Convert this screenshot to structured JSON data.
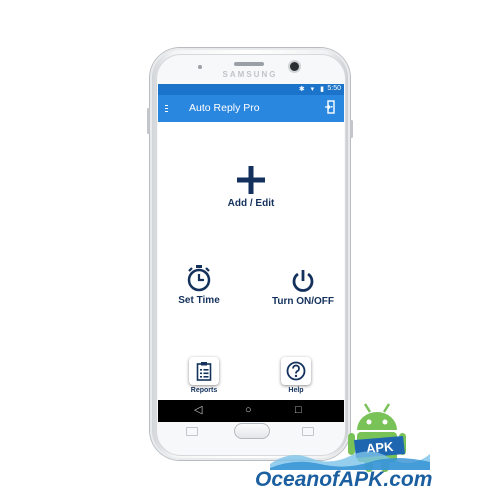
{
  "phone": {
    "brand": "SAMSUNG"
  },
  "status_bar": {
    "icons": "✱ ▾ ▮",
    "time": "5:50"
  },
  "app_bar": {
    "menu_icon": "menu-icon",
    "title": "Auto Reply Pro",
    "exit_icon": "exit-door-icon"
  },
  "actions": {
    "add_edit": {
      "label": "Add / Edit",
      "icon": "plus-icon"
    },
    "set_time": {
      "label": "Set Time",
      "icon": "stopwatch-icon"
    },
    "turn_on_off": {
      "label": "Turn ON/OFF",
      "icon": "power-icon"
    },
    "reports": {
      "label": "Reports",
      "icon": "clipboard-icon"
    },
    "help": {
      "label": "Help",
      "icon": "question-icon"
    }
  },
  "nav_bar": {
    "back": "◁",
    "home": "○",
    "recent": "□"
  },
  "watermark": {
    "text": "OceanofAPK.com",
    "badge": "APK"
  },
  "colors": {
    "primary": "#2a87e0",
    "status": "#1b74c9",
    "icon_navy": "#13315c",
    "android_green": "#78c257"
  }
}
